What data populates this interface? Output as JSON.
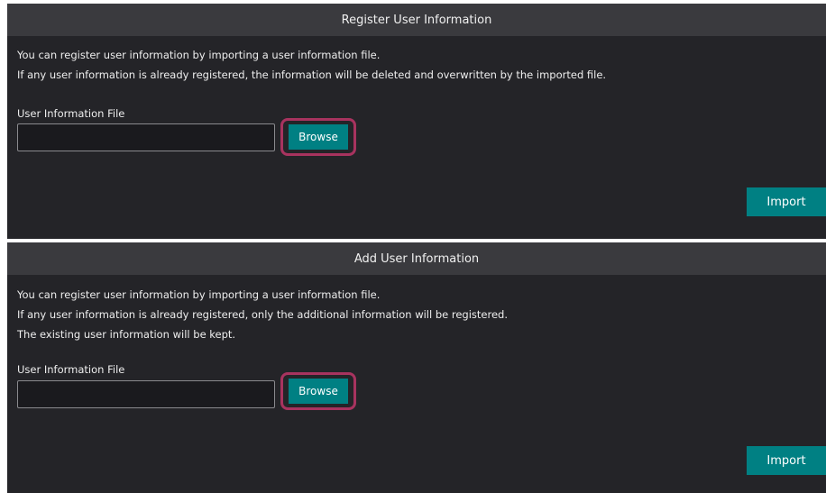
{
  "register": {
    "title": "Register User Information",
    "description": [
      "You can register user information by importing a user information file.",
      "If any user information is already registered, the information will be deleted and overwritten by the imported file."
    ],
    "file_label": "User Information File",
    "file_value": "",
    "browse_label": "Browse",
    "import_label": "Import"
  },
  "add": {
    "title": "Add User Information",
    "description": [
      "You can register user information by importing a user information file.",
      "If any user information is already registered, only the additional information will be registered.",
      "The existing user information will be kept."
    ],
    "file_label": "User Information File",
    "file_value": "",
    "browse_label": "Browse",
    "import_label": "Import"
  },
  "colors": {
    "accent_button": "#008083",
    "highlight_border": "#a8335f",
    "panel_background": "#242428",
    "header_background": "#3a3a3e"
  }
}
